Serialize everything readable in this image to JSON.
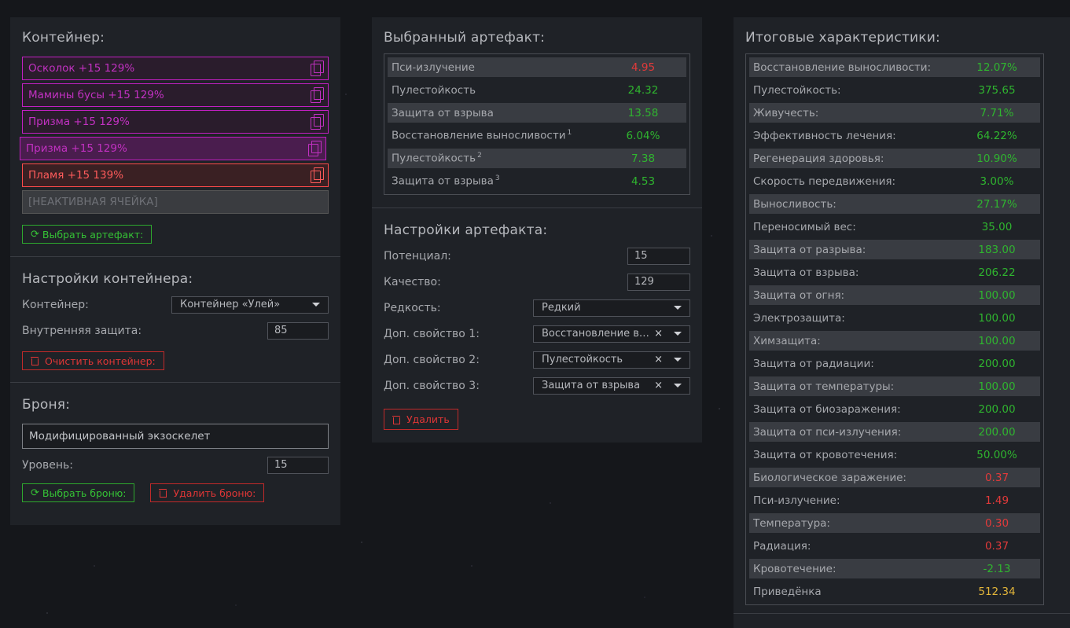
{
  "container_panel": {
    "title": "Контейнер:",
    "slots": [
      {
        "label": "Осколок +15 129%"
      },
      {
        "label": "Мамины бусы +15 129%"
      },
      {
        "label": "Призма +15 129%"
      },
      {
        "label": "Призма +15 129%"
      },
      {
        "label": "Пламя +15 139%"
      },
      {
        "label": "[НЕАКТИВНАЯ ЯЧЕЙКА]"
      }
    ],
    "select_artifact": "Выбрать артефакт:"
  },
  "container_settings": {
    "title": "Настройки контейнера:",
    "container_label": "Контейнер:",
    "container_value": "Контейнер «Улей»",
    "inner_protection_label": "Внутренняя защита:",
    "inner_protection_value": "85",
    "clear_button": "Очистить контейнер:"
  },
  "armor": {
    "title": "Броня:",
    "name": "Модифицированный экзоскелет",
    "level_label": "Уровень:",
    "level_value": "15",
    "select_button": "Выбрать броню:",
    "delete_button": "Удалить броню:"
  },
  "selected_artifact": {
    "title": "Выбранный артефакт:",
    "rows": [
      {
        "label": "Пси-излучение",
        "sup": "",
        "value": "4.95",
        "color": "red"
      },
      {
        "label": "Пулестойкость",
        "sup": "",
        "value": "24.32",
        "color": "green"
      },
      {
        "label": "Защита от взрыва",
        "sup": "",
        "value": "13.58",
        "color": "green"
      },
      {
        "label": "Восстановление выносливости",
        "sup": "1",
        "value": "6.04%",
        "color": "green"
      },
      {
        "label": "Пулестойкость",
        "sup": "2",
        "value": "7.38",
        "color": "green"
      },
      {
        "label": "Защита от взрыва",
        "sup": "3",
        "value": "4.53",
        "color": "green"
      }
    ]
  },
  "artifact_settings": {
    "title": "Настройки артефакта:",
    "potential_label": "Потенциал:",
    "potential_value": "15",
    "quality_label": "Качество:",
    "quality_value": "129",
    "rarity_label": "Редкость:",
    "rarity_value": "Редкий",
    "extra1_label": "Доп. свойство 1:",
    "extra1_value": "Восстановление выносливости",
    "extra2_label": "Доп. свойство 2:",
    "extra2_value": "Пулестойкость",
    "extra3_label": "Доп. свойство 3:",
    "extra3_value": "Защита от взрыва",
    "clear_x": "×",
    "delete_button": "Удалить"
  },
  "totals": {
    "title": "Итоговые характеристики:",
    "rows": [
      {
        "label": "Восстановление выносливости:",
        "value": "12.07%",
        "color": "green"
      },
      {
        "label": "Пулестойкость:",
        "value": "375.65",
        "color": "green"
      },
      {
        "label": "Живучесть:",
        "value": "7.71%",
        "color": "green"
      },
      {
        "label": "Эффективность лечения:",
        "value": "64.22%",
        "color": "green"
      },
      {
        "label": "Регенерация здоровья:",
        "value": "10.90%",
        "color": "green"
      },
      {
        "label": "Скорость передвижения:",
        "value": "3.00%",
        "color": "green"
      },
      {
        "label": "Выносливость:",
        "value": "27.17%",
        "color": "green"
      },
      {
        "label": "Переносимый вес:",
        "value": "35.00",
        "color": "green"
      },
      {
        "label": "Защита от разрыва:",
        "value": "183.00",
        "color": "green"
      },
      {
        "label": "Защита от взрыва:",
        "value": "206.22",
        "color": "green"
      },
      {
        "label": "Защита от огня:",
        "value": "100.00",
        "color": "green"
      },
      {
        "label": "Электрозащита:",
        "value": "100.00",
        "color": "green"
      },
      {
        "label": "Химзащита:",
        "value": "100.00",
        "color": "green"
      },
      {
        "label": "Защита от радиации:",
        "value": "200.00",
        "color": "green"
      },
      {
        "label": "Защита от температуры:",
        "value": "100.00",
        "color": "green"
      },
      {
        "label": "Защита от биозаражения:",
        "value": "200.00",
        "color": "green"
      },
      {
        "label": "Защита от пси-излучения:",
        "value": "200.00",
        "color": "green"
      },
      {
        "label": "Защита от кровотечения:",
        "value": "50.00%",
        "color": "green"
      },
      {
        "label": "Биологическое заражение:",
        "value": "0.37",
        "color": "red"
      },
      {
        "label": "Пси-излучение:",
        "value": "1.49",
        "color": "red"
      },
      {
        "label": "Температура:",
        "value": "0.30",
        "color": "red"
      },
      {
        "label": "Радиация:",
        "value": "0.37",
        "color": "red"
      },
      {
        "label": "Кровотечение:",
        "value": "-2.13",
        "color": "green"
      },
      {
        "label": "Приведёнка",
        "value": "512.34",
        "color": "yellow"
      }
    ]
  }
}
